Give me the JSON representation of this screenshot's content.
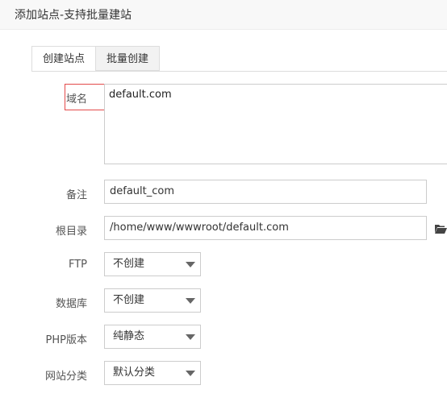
{
  "window": {
    "title": "添加站点-支持批量建站"
  },
  "tabs": [
    {
      "label": "创建站点"
    },
    {
      "label": "批量创建"
    }
  ],
  "form": {
    "domain": {
      "label": "域名",
      "value": "default.com"
    },
    "remark": {
      "label": "备注",
      "value": "default_com"
    },
    "root_dir": {
      "label": "根目录",
      "value": "/home/www/wwwroot/default.com"
    },
    "ftp": {
      "label": "FTP",
      "selected": "不创建"
    },
    "database": {
      "label": "数据库",
      "selected": "不创建"
    },
    "php_version": {
      "label": "PHP版本",
      "selected": "纯静态"
    },
    "site_category": {
      "label": "网站分类",
      "selected": "默认分类"
    }
  },
  "colors": {
    "highlight_border": "#e34a4a",
    "input_border": "#cccccc"
  },
  "icons": {
    "folder": "folder-open-icon",
    "select_arrow": "caret-down-icon"
  }
}
